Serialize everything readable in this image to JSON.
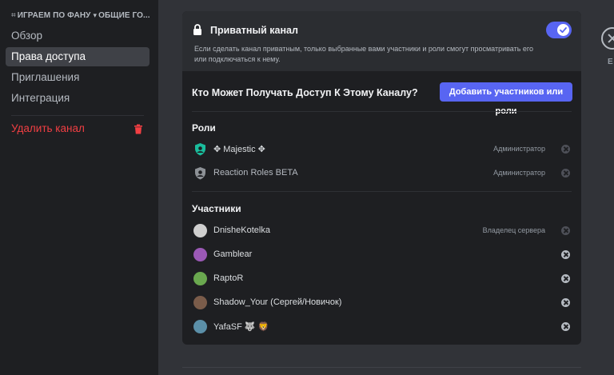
{
  "sidebar": {
    "breadcrumb": {
      "channel": "ИГРАЕМ ПО ФАНУ",
      "category": "ОБЩИЕ ГО..."
    },
    "items": [
      {
        "label": "Обзор"
      },
      {
        "label": "Права доступа"
      },
      {
        "label": "Приглашения"
      },
      {
        "label": "Интеграция"
      }
    ],
    "delete_label": "Удалить канал",
    "active_index": 1
  },
  "private": {
    "title": "Приватный канал",
    "description": "Если сделать канал приватным, только выбранные вами участники и роли смогут просматривать его или подключаться к нему.",
    "enabled": true
  },
  "access": {
    "title": "Кто Может Получать Доступ К Этому Каналу?",
    "add_button": "Добавить участников или роли"
  },
  "roles": {
    "heading": "Роли",
    "items": [
      {
        "name": "✥ Majestic ✥",
        "tag": "Администратор",
        "color": "#1abc9c"
      },
      {
        "name": "Reaction Roles BETA",
        "tag": "Администратор",
        "color": "#8e9297"
      }
    ]
  },
  "members": {
    "heading": "Участники",
    "items": [
      {
        "name": "DnisheKotelka",
        "tag": "Владелец сервера",
        "color": "#cfcfcf"
      },
      {
        "name": "Gamblear",
        "tag": "",
        "color": "#9b59b6"
      },
      {
        "name": "RaptoR",
        "tag": "",
        "color": "#6aa84f"
      },
      {
        "name": "Shadow_Your (Сергей/Новичок)",
        "tag": "",
        "color": "#7a5c4a"
      },
      {
        "name": "YafaSF 🐺 🦁",
        "tag": "",
        "color": "#5b8fa8"
      }
    ]
  },
  "close": {
    "label": "E"
  },
  "colors": {
    "accent": "#5865f2",
    "danger": "#f23f43"
  }
}
